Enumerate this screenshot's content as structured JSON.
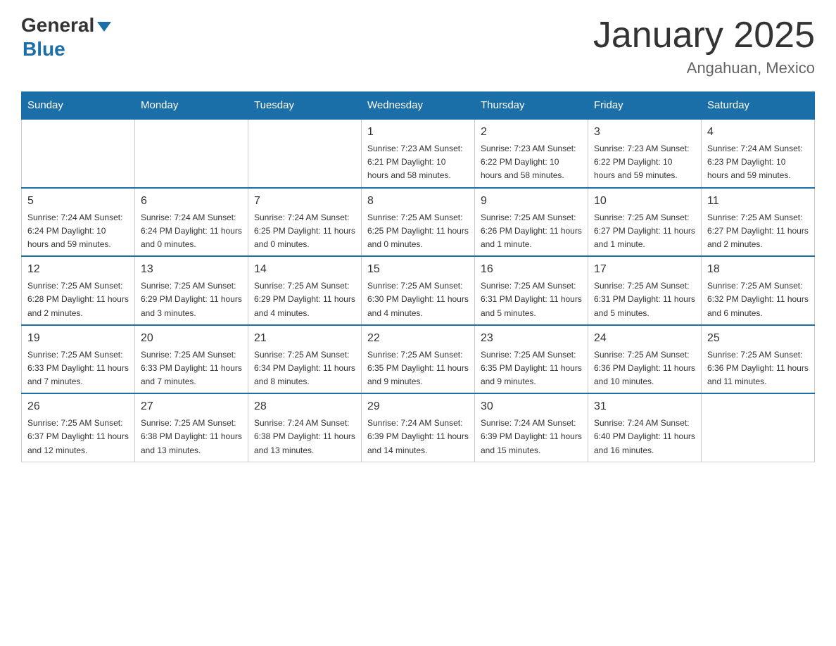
{
  "header": {
    "logo_general": "General",
    "logo_blue": "Blue",
    "title": "January 2025",
    "subtitle": "Angahuan, Mexico"
  },
  "weekdays": [
    "Sunday",
    "Monday",
    "Tuesday",
    "Wednesday",
    "Thursday",
    "Friday",
    "Saturday"
  ],
  "weeks": [
    [
      {
        "day": "",
        "info": ""
      },
      {
        "day": "",
        "info": ""
      },
      {
        "day": "",
        "info": ""
      },
      {
        "day": "1",
        "info": "Sunrise: 7:23 AM\nSunset: 6:21 PM\nDaylight: 10 hours and 58 minutes."
      },
      {
        "day": "2",
        "info": "Sunrise: 7:23 AM\nSunset: 6:22 PM\nDaylight: 10 hours and 58 minutes."
      },
      {
        "day": "3",
        "info": "Sunrise: 7:23 AM\nSunset: 6:22 PM\nDaylight: 10 hours and 59 minutes."
      },
      {
        "day": "4",
        "info": "Sunrise: 7:24 AM\nSunset: 6:23 PM\nDaylight: 10 hours and 59 minutes."
      }
    ],
    [
      {
        "day": "5",
        "info": "Sunrise: 7:24 AM\nSunset: 6:24 PM\nDaylight: 10 hours and 59 minutes."
      },
      {
        "day": "6",
        "info": "Sunrise: 7:24 AM\nSunset: 6:24 PM\nDaylight: 11 hours and 0 minutes."
      },
      {
        "day": "7",
        "info": "Sunrise: 7:24 AM\nSunset: 6:25 PM\nDaylight: 11 hours and 0 minutes."
      },
      {
        "day": "8",
        "info": "Sunrise: 7:25 AM\nSunset: 6:25 PM\nDaylight: 11 hours and 0 minutes."
      },
      {
        "day": "9",
        "info": "Sunrise: 7:25 AM\nSunset: 6:26 PM\nDaylight: 11 hours and 1 minute."
      },
      {
        "day": "10",
        "info": "Sunrise: 7:25 AM\nSunset: 6:27 PM\nDaylight: 11 hours and 1 minute."
      },
      {
        "day": "11",
        "info": "Sunrise: 7:25 AM\nSunset: 6:27 PM\nDaylight: 11 hours and 2 minutes."
      }
    ],
    [
      {
        "day": "12",
        "info": "Sunrise: 7:25 AM\nSunset: 6:28 PM\nDaylight: 11 hours and 2 minutes."
      },
      {
        "day": "13",
        "info": "Sunrise: 7:25 AM\nSunset: 6:29 PM\nDaylight: 11 hours and 3 minutes."
      },
      {
        "day": "14",
        "info": "Sunrise: 7:25 AM\nSunset: 6:29 PM\nDaylight: 11 hours and 4 minutes."
      },
      {
        "day": "15",
        "info": "Sunrise: 7:25 AM\nSunset: 6:30 PM\nDaylight: 11 hours and 4 minutes."
      },
      {
        "day": "16",
        "info": "Sunrise: 7:25 AM\nSunset: 6:31 PM\nDaylight: 11 hours and 5 minutes."
      },
      {
        "day": "17",
        "info": "Sunrise: 7:25 AM\nSunset: 6:31 PM\nDaylight: 11 hours and 5 minutes."
      },
      {
        "day": "18",
        "info": "Sunrise: 7:25 AM\nSunset: 6:32 PM\nDaylight: 11 hours and 6 minutes."
      }
    ],
    [
      {
        "day": "19",
        "info": "Sunrise: 7:25 AM\nSunset: 6:33 PM\nDaylight: 11 hours and 7 minutes."
      },
      {
        "day": "20",
        "info": "Sunrise: 7:25 AM\nSunset: 6:33 PM\nDaylight: 11 hours and 7 minutes."
      },
      {
        "day": "21",
        "info": "Sunrise: 7:25 AM\nSunset: 6:34 PM\nDaylight: 11 hours and 8 minutes."
      },
      {
        "day": "22",
        "info": "Sunrise: 7:25 AM\nSunset: 6:35 PM\nDaylight: 11 hours and 9 minutes."
      },
      {
        "day": "23",
        "info": "Sunrise: 7:25 AM\nSunset: 6:35 PM\nDaylight: 11 hours and 9 minutes."
      },
      {
        "day": "24",
        "info": "Sunrise: 7:25 AM\nSunset: 6:36 PM\nDaylight: 11 hours and 10 minutes."
      },
      {
        "day": "25",
        "info": "Sunrise: 7:25 AM\nSunset: 6:36 PM\nDaylight: 11 hours and 11 minutes."
      }
    ],
    [
      {
        "day": "26",
        "info": "Sunrise: 7:25 AM\nSunset: 6:37 PM\nDaylight: 11 hours and 12 minutes."
      },
      {
        "day": "27",
        "info": "Sunrise: 7:25 AM\nSunset: 6:38 PM\nDaylight: 11 hours and 13 minutes."
      },
      {
        "day": "28",
        "info": "Sunrise: 7:24 AM\nSunset: 6:38 PM\nDaylight: 11 hours and 13 minutes."
      },
      {
        "day": "29",
        "info": "Sunrise: 7:24 AM\nSunset: 6:39 PM\nDaylight: 11 hours and 14 minutes."
      },
      {
        "day": "30",
        "info": "Sunrise: 7:24 AM\nSunset: 6:39 PM\nDaylight: 11 hours and 15 minutes."
      },
      {
        "day": "31",
        "info": "Sunrise: 7:24 AM\nSunset: 6:40 PM\nDaylight: 11 hours and 16 minutes."
      },
      {
        "day": "",
        "info": ""
      }
    ]
  ]
}
